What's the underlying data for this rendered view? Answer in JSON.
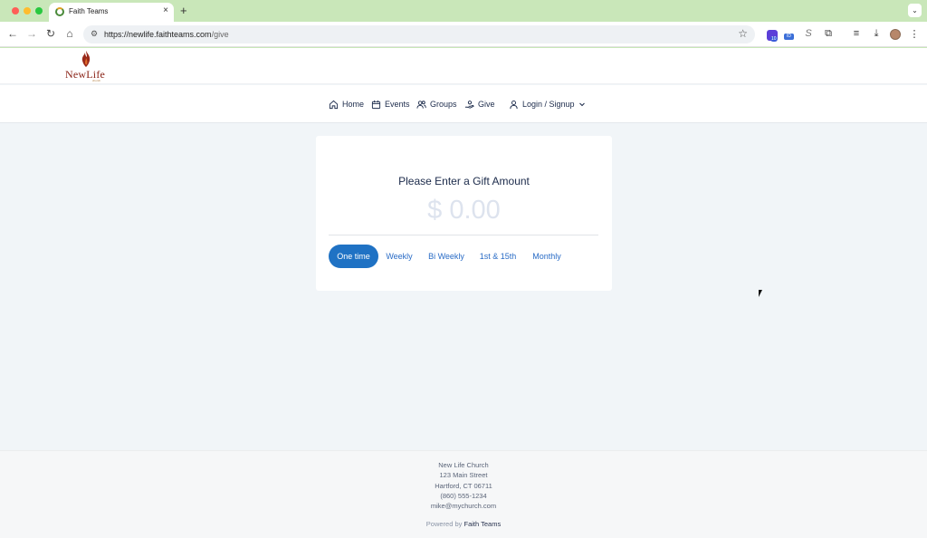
{
  "browser": {
    "tab_title": "Faith Teams",
    "tab_close": "×",
    "new_tab": "+",
    "tab_menu": "⌄",
    "url_host": "https://newlife.faithteams.com",
    "url_path": "/give",
    "nav": {
      "back": "←",
      "forward": "→",
      "reload": "↻",
      "home": "⌂"
    },
    "omni_tune": "⚙",
    "star": "☆",
    "ext_badge_count": "10",
    "ext_tag": "ID",
    "ext_s": "S",
    "ext_puzzle": "⧉",
    "ext_media": "≡",
    "ext_download": "⤓",
    "ext_menu": "⋮"
  },
  "site": {
    "logo_text": "NewLife",
    "logo_sub": "church",
    "nav": [
      {
        "label": "Home",
        "icon": "home-icon"
      },
      {
        "label": "Events",
        "icon": "calendar-icon"
      },
      {
        "label": "Groups",
        "icon": "users-icon"
      },
      {
        "label": "Give",
        "icon": "give-hand-icon"
      },
      {
        "label": "Login / Signup",
        "icon": "user-icon",
        "chevron": "chevron-down-icon"
      }
    ]
  },
  "give": {
    "title": "Please Enter a Gift Amount",
    "amount_placeholder": "$ 0.00",
    "frequencies": [
      "One time",
      "Weekly",
      "Bi Weekly",
      "1st & 15th",
      "Monthly"
    ],
    "selected": "One time"
  },
  "footer": {
    "name": "New Life Church",
    "street": "123 Main Street",
    "city": "Hartford, CT 06711",
    "phone": "(860) 555-1234",
    "email": "mike@mychurch.com",
    "powered_prefix": "Powered by",
    "powered_brand": "Faith Teams"
  },
  "colors": {
    "accent": "#1f72c4",
    "nav_text": "#1b2a4a",
    "page_bg": "#f1f5f8",
    "logo_red": "#8b2418"
  }
}
